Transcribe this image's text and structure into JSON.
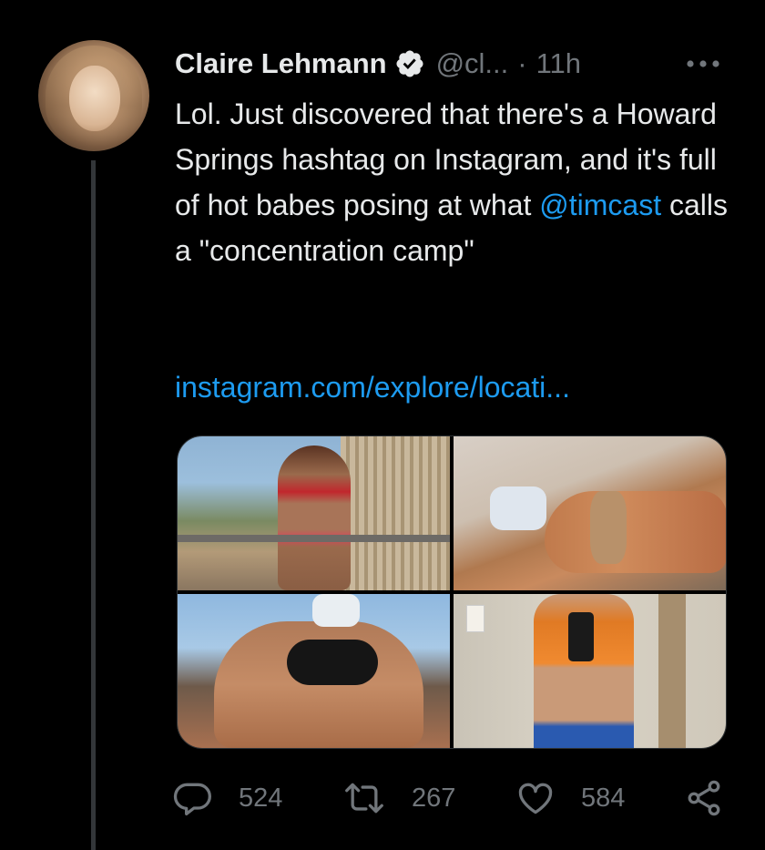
{
  "tweet": {
    "author_name": "Claire Lehmann",
    "handle": "@cl...",
    "separator": "·",
    "time": "11h",
    "text_part1": "Lol. Just discovered that there's a Howard Springs hashtag on Instagram, and it's full of hot babes posing at what ",
    "mention": "@timcast",
    "text_part2": " calls a \"concentration camp\"",
    "link": "instagram.com/explore/locati...",
    "replies": "524",
    "retweets": "267",
    "likes": "584"
  },
  "icons": {
    "verified": "verified-badge-icon",
    "more": "more-horizontal-icon",
    "reply": "reply-icon",
    "retweet": "retweet-icon",
    "like": "heart-icon",
    "share": "share-icon"
  },
  "colors": {
    "background": "#000000",
    "text": "#e7e9ea",
    "secondary": "#71767b",
    "link": "#1d9bf0",
    "thread_line": "#333639"
  }
}
